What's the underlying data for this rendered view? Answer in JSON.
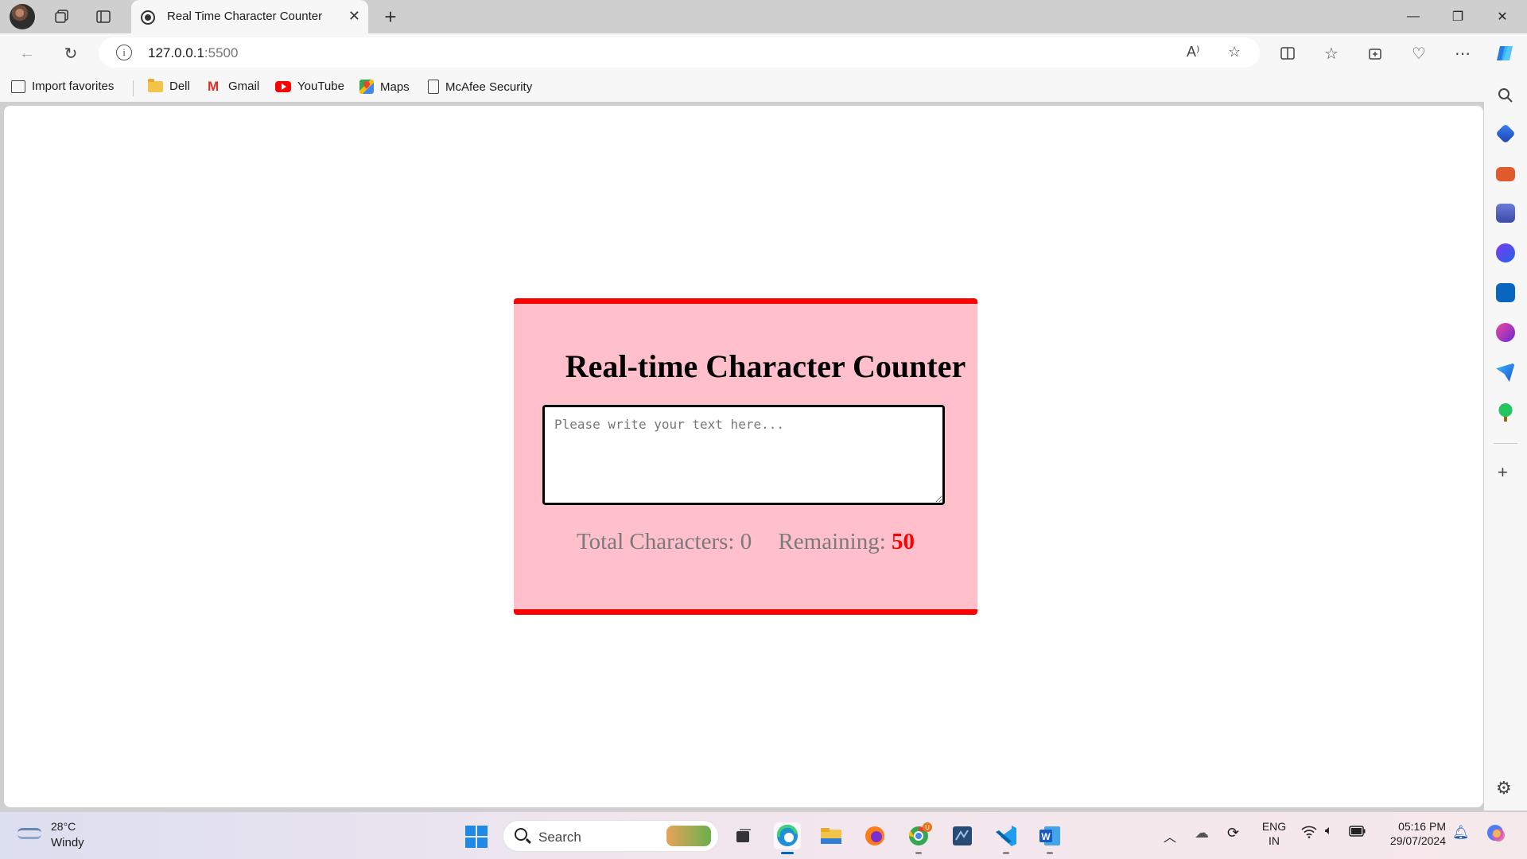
{
  "browser": {
    "tab_title": "Real Time Character Counter",
    "url_host": "127.0.0.1",
    "url_port": ":5500"
  },
  "favorites": [
    {
      "label": "Import favorites",
      "icon": "import-icon"
    },
    {
      "label": "Dell",
      "icon": "folder-icon"
    },
    {
      "label": "Gmail",
      "icon": "gmail-icon"
    },
    {
      "label": "YouTube",
      "icon": "youtube-icon"
    },
    {
      "label": "Maps",
      "icon": "maps-icon"
    },
    {
      "label": "McAfee Security",
      "icon": "page-icon"
    }
  ],
  "page": {
    "heading": "Real-time Character Counter",
    "textarea_placeholder": "Please write your text here...",
    "total_label": "Total Characters:",
    "total_value": "0",
    "remaining_label": "Remaining:",
    "remaining_value": "50",
    "colors": {
      "card_bg": "#ffc0cb",
      "accent": "#ff0000"
    }
  },
  "taskbar": {
    "weather_temp": "28°C",
    "weather_desc": "Windy",
    "search_label": "Search",
    "lang_line1": "ENG",
    "lang_line2": "IN",
    "time": "05:16 PM",
    "date": "29/07/2024",
    "chrome_badge": "U"
  }
}
